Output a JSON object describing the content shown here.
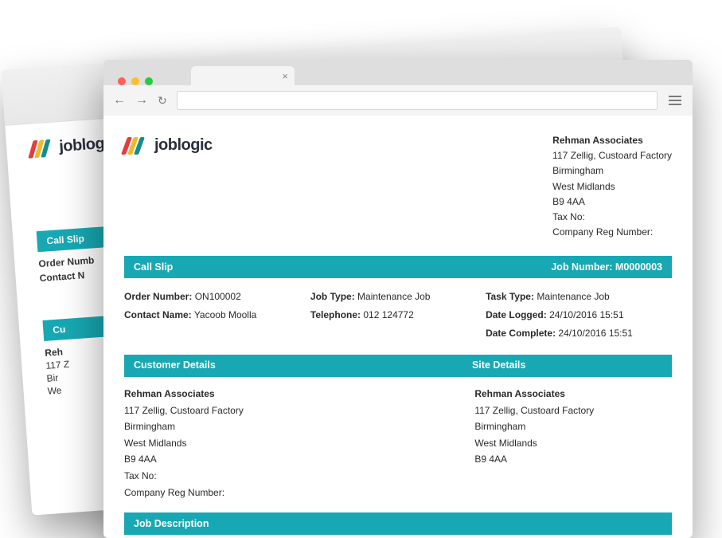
{
  "brand": {
    "name": "joblogic"
  },
  "header_company": {
    "name": "Rehman Associates",
    "line1": "117 Zellig, Custoard Factory",
    "city": "Birmingham",
    "region": "West Midlands",
    "postcode": "B9 4AA",
    "tax": "Tax No:",
    "reg": "Company Reg Number:"
  },
  "call_slip": {
    "title": "Call Slip",
    "job_number_label": "Job Number: M0000003",
    "order_label": "Order Number:",
    "order_value": "ON100002",
    "contact_label": "Contact Name:",
    "contact_value": "Yacoob Moolla",
    "jobtype_label": "Job Type:",
    "jobtype_value": "Maintenance Job",
    "tel_label": "Telephone:",
    "tel_value": "012 124772",
    "tasktype_label": "Task Type:",
    "tasktype_value": "Maintenance Job",
    "logged_label": "Date Logged:",
    "logged_value": "24/10/2016   15:51",
    "complete_label": "Date Complete:",
    "complete_value": "24/10/2016   15:51"
  },
  "details_bar": {
    "left": "Customer Details",
    "right": "Site Details"
  },
  "customer": {
    "name": "Rehman Associates",
    "line1": "117 Zellig, Custoard Factory",
    "city": "Birmingham",
    "region": "West Midlands",
    "postcode": "B9 4AA",
    "tax": "Tax No:",
    "reg": "Company Reg Number:"
  },
  "site": {
    "name": "Rehman Associates",
    "line1": "117 Zellig, Custoard Factory",
    "city": "Birmingham",
    "region": "West Midlands",
    "postcode": "B9 4AA"
  },
  "job_desc": {
    "title": "Job Description"
  },
  "bg": {
    "callslip": "Call Slip",
    "order": "Order Numb",
    "contact": "Contact N",
    "cust_initial": "Cu",
    "reh": "Reh",
    "a117": "117 Z",
    "birm": "Bir",
    "west": "We"
  }
}
